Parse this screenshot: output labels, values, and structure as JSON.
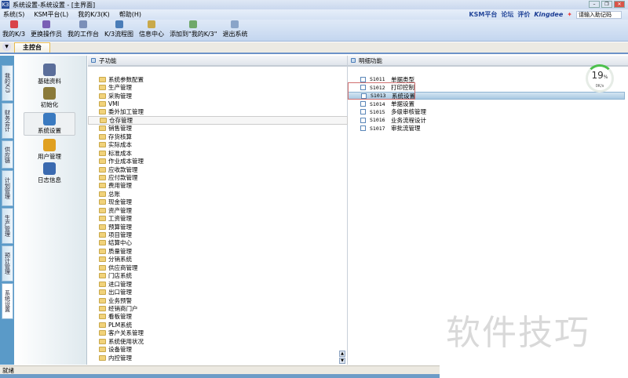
{
  "window": {
    "title": "系统设置-系统设置 - [主界面]",
    "logo": "K3"
  },
  "menu": [
    "系统(S)",
    "KSM平台(L)",
    "我的K/3(K)",
    "帮助(H)"
  ],
  "top_links": {
    "ksm": "KSM平台",
    "forum": "论坛",
    "rate": "评价",
    "brand": "Kingdee",
    "search_placeholder": "请输入助记码"
  },
  "toolbar": [
    {
      "label": "我的K/3",
      "color": "#d9434a"
    },
    {
      "label": "更换操作员",
      "color": "#7a5fb5"
    },
    {
      "label": "我的工作台",
      "color": "#7b8fb8"
    },
    {
      "label": "K/3流程图",
      "color": "#4a7db8"
    },
    {
      "label": "信息中心",
      "color": "#c9a94a"
    },
    {
      "label": "添加到\"我的K/3\"",
      "color": "#6fa86a"
    },
    {
      "label": "退出系统",
      "color": "#8aa4c8"
    }
  ],
  "tabs": {
    "main": "主控台"
  },
  "vertical_tabs": [
    "我的K/3",
    "财务会计",
    "供应链",
    "计划管理",
    "生产管理",
    "预计管理",
    "系统设置"
  ],
  "icon_panel": [
    {
      "label": "基础资料",
      "color": "#5a6e9a"
    },
    {
      "label": "初始化",
      "color": "#8a7a3a"
    },
    {
      "label": "系统设置",
      "color": "#3a7ac0",
      "selected": true
    },
    {
      "label": "用户管理",
      "color": "#e0a020"
    },
    {
      "label": "日志信息",
      "color": "#3a6ab0"
    }
  ],
  "sub_panel": {
    "title": "子功能",
    "items": [
      "系统参数配置",
      "生产管理",
      "采购管理",
      "VMI",
      "委外加工管理",
      "仓存管理",
      "销售管理",
      "存货核算",
      "实际成本",
      "标准成本",
      "作业成本管理",
      "应收款管理",
      "应付款管理",
      "费用管理",
      "总账",
      "现金管理",
      "资产管理",
      "工资管理",
      "预算管理",
      "项目管理",
      "结算中心",
      "质量管理",
      "分销系统",
      "供应商管理",
      "门店系统",
      "进口管理",
      "出口管理",
      "业务预警",
      "经销商门户",
      "看板管理",
      "PLM系统",
      "客户关系管理",
      "系统使用状况",
      "设备管理",
      "内控管理"
    ],
    "selected_index": 5
  },
  "detail_panel": {
    "title": "明细功能",
    "items": [
      {
        "code": "S1011",
        "label": "单据类型"
      },
      {
        "code": "S1012",
        "label": "打印控制"
      },
      {
        "code": "S1013",
        "label": "系统设置"
      },
      {
        "code": "S1014",
        "label": "单据设置"
      },
      {
        "code": "S1015",
        "label": "多级审核管理"
      },
      {
        "code": "S1016",
        "label": "业务流程设计"
      },
      {
        "code": "S1017",
        "label": "审批流管理"
      }
    ],
    "selected_index": 2
  },
  "gauge": {
    "percent": "19",
    "unit": "%",
    "speed": "0K/s"
  },
  "status": {
    "text": "就绪"
  },
  "watermark": "软件技巧"
}
